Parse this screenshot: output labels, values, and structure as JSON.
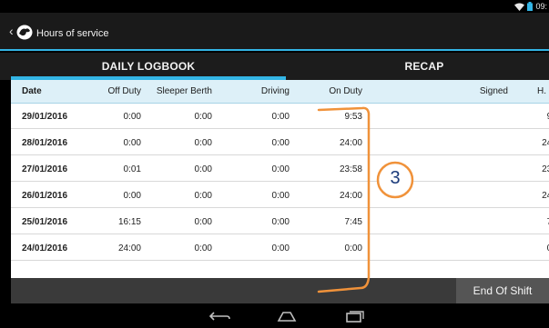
{
  "status_bar": {
    "time": "09:"
  },
  "header": {
    "title": "Hours of service"
  },
  "tabs": [
    {
      "label": "DAILY LOGBOOK",
      "active": true
    },
    {
      "label": "RECAP",
      "active": false
    }
  ],
  "table": {
    "columns": [
      "Date",
      "Off Duty",
      "Sleeper Berth",
      "Driving",
      "On Duty",
      "Signed",
      "H.​"
    ],
    "rows": [
      {
        "date": "29/01/2016",
        "off_duty": "0:00",
        "sleeper_berth": "0:00",
        "driving": "0:00",
        "on_duty": "9:53",
        "signed": "",
        "hw": "9:"
      },
      {
        "date": "28/01/2016",
        "off_duty": "0:00",
        "sleeper_berth": "0:00",
        "driving": "0:00",
        "on_duty": "24:00",
        "signed": "",
        "hw": "24:"
      },
      {
        "date": "27/01/2016",
        "off_duty": "0:01",
        "sleeper_berth": "0:00",
        "driving": "0:00",
        "on_duty": "23:58",
        "signed": "",
        "hw": "23:"
      },
      {
        "date": "26/01/2016",
        "off_duty": "0:00",
        "sleeper_berth": "0:00",
        "driving": "0:00",
        "on_duty": "24:00",
        "signed": "",
        "hw": "24:"
      },
      {
        "date": "25/01/2016",
        "off_duty": "16:15",
        "sleeper_berth": "0:00",
        "driving": "0:00",
        "on_duty": "7:45",
        "signed": "",
        "hw": "7:"
      },
      {
        "date": "24/01/2016",
        "off_duty": "24:00",
        "sleeper_berth": "0:00",
        "driving": "0:00",
        "on_duty": "0:00",
        "signed": "",
        "hw": "0:"
      }
    ]
  },
  "annotation": {
    "label": "3",
    "color": "#f0923a"
  },
  "footer": {
    "end_shift_label": "End Of Shift"
  },
  "colors": {
    "accent": "#33b5e5",
    "header_bg": "#ddf0f8",
    "bar_bg": "#1c1c1c"
  }
}
